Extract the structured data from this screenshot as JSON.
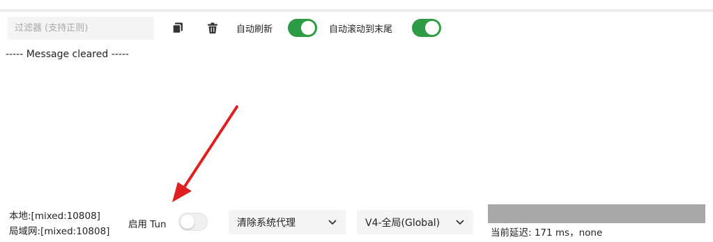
{
  "toolbar": {
    "filter_placeholder": "过滤器 (支持正则)",
    "filter_value": "",
    "copy_icon": "copy-icon",
    "delete_icon": "trash-icon",
    "auto_refresh_label": "自动刷新",
    "auto_refresh_on": true,
    "auto_scroll_label": "自动滚动到末尾",
    "auto_scroll_on": true
  },
  "log": {
    "message": "----- Message cleared -----"
  },
  "status_bar": {
    "local_port": "本地:[mixed:10808]",
    "lan_port": "局域网:[mixed:10808]",
    "tun_label": "启用 Tun",
    "tun_on": false,
    "system_proxy_select": "清除系统代理",
    "routing_mode_select": "V4-全局(Global)",
    "latency": "当前延迟: 171 ms，none"
  },
  "colors": {
    "toggle_on": "#2e9b45",
    "annotation_arrow": "#e02020",
    "placeholder_block": "#a8a8a8"
  }
}
